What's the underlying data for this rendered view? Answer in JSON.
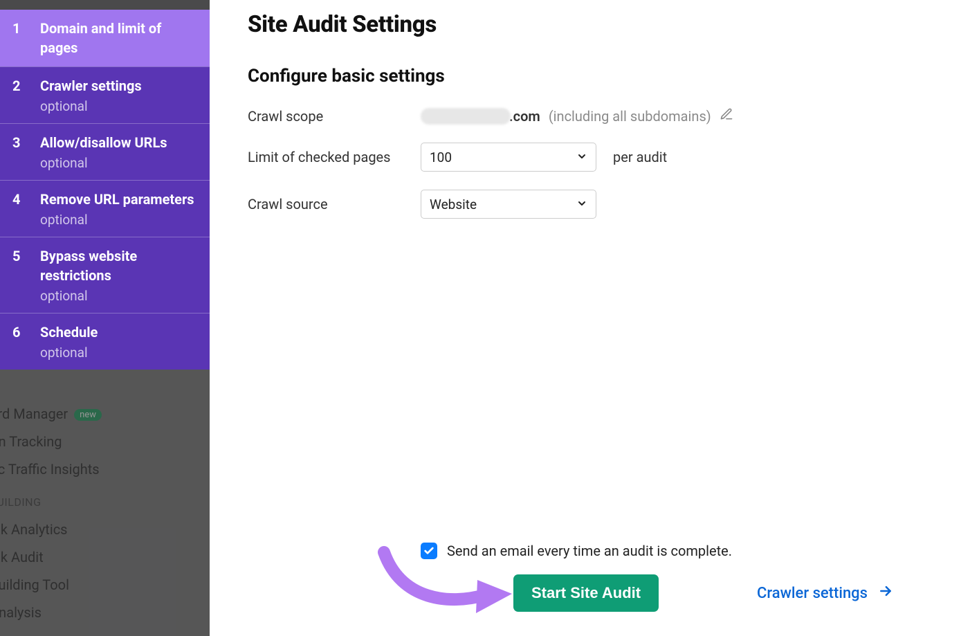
{
  "wizard": {
    "steps": [
      {
        "num": "1",
        "title": "Domain and limit of pages",
        "sub": "",
        "active": true
      },
      {
        "num": "2",
        "title": "Crawler settings",
        "sub": "optional",
        "active": false
      },
      {
        "num": "3",
        "title": "Allow/disallow URLs",
        "sub": "optional",
        "active": false
      },
      {
        "num": "4",
        "title": "Remove URL parameters",
        "sub": "optional",
        "active": false
      },
      {
        "num": "5",
        "title": "Bypass website restrictions",
        "sub": "optional",
        "active": false
      },
      {
        "num": "6",
        "title": "Schedule",
        "sub": "optional",
        "active": false
      }
    ]
  },
  "bg_nav": {
    "items_top": [
      "word Manager",
      "ition Tracking",
      "anic Traffic Insights"
    ],
    "new_badge": "new",
    "section": "K BUILDING",
    "items_bottom": [
      "klink Analytics",
      "klink Audit",
      "k Building Tool",
      "k Analysis"
    ]
  },
  "main": {
    "title": "Site Audit Settings",
    "subtitle": "Configure basic settings",
    "rows": {
      "crawl_scope_label": "Crawl scope",
      "crawl_scope_domain_suffix": ".com",
      "crawl_scope_hint": "(including all subdomains)",
      "limit_label": "Limit of checked pages",
      "limit_value": "100",
      "limit_unit": "per audit",
      "source_label": "Crawl source",
      "source_value": "Website"
    },
    "email_label": "Send an email every time an audit is complete.",
    "start_button": "Start Site Audit",
    "next_link": "Crawler settings"
  }
}
